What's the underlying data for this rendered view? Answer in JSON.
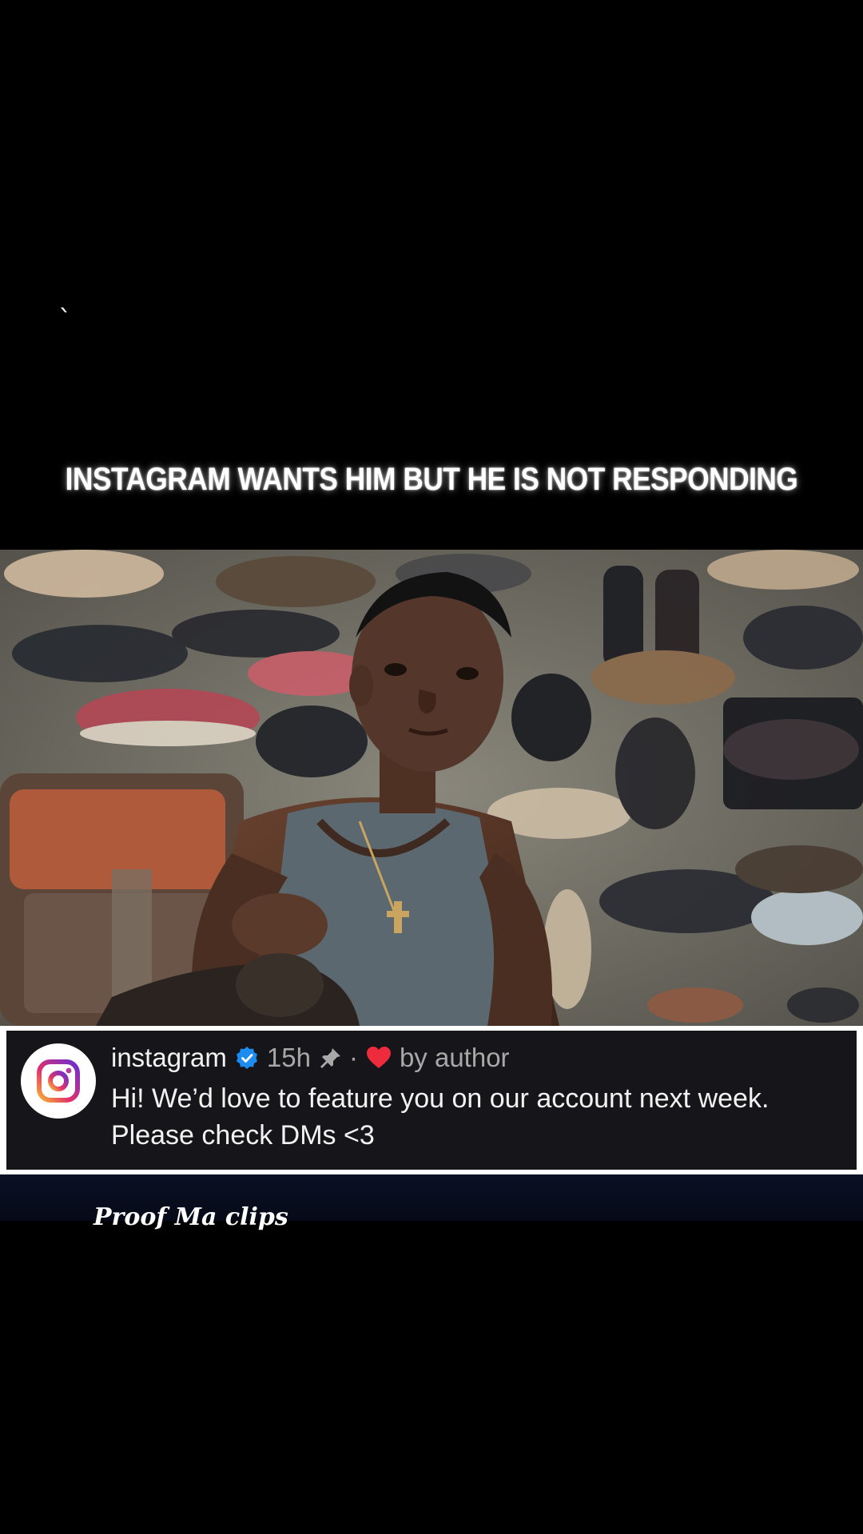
{
  "overlay": {
    "mark": "`",
    "headline": "INSTAGRAM WANTS HIM BUT HE IS NOT RESPONDING"
  },
  "photo": {
    "icon": "photo-of-boy-with-shoes"
  },
  "comment": {
    "username": "instagram",
    "verified_icon": "verified-badge-icon",
    "time": "15h",
    "pin_icon": "pin-icon",
    "separator": "·",
    "heart_icon": "heart-icon",
    "liked_by": "by author",
    "text": "Hi! We’d love to feature you on our account next week. Please check DMs <3",
    "colors": {
      "heart": "#ed2b3d",
      "verified": "#1d8cf0",
      "card_bg": "#16161a"
    }
  },
  "watermark": {
    "text": "Proof Ma clips"
  }
}
